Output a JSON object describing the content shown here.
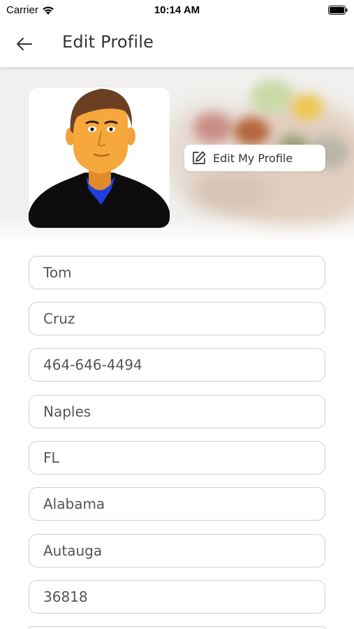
{
  "status_bar": {
    "carrier": "Carrier",
    "time": "10:14 AM"
  },
  "header": {
    "title": "Edit Profile"
  },
  "profile": {
    "edit_button_label": "Edit My Profile"
  },
  "form": {
    "fields": [
      {
        "name": "first-name",
        "value": "Tom"
      },
      {
        "name": "last-name",
        "value": "Cruz"
      },
      {
        "name": "phone",
        "value": "464-646-4494"
      },
      {
        "name": "city",
        "value": "Naples"
      },
      {
        "name": "state-code",
        "value": "FL"
      },
      {
        "name": "state",
        "value": "Alabama"
      },
      {
        "name": "county",
        "value": "Autauga"
      },
      {
        "name": "zip",
        "value": "36818"
      }
    ]
  },
  "colors": {
    "avatar_skin": "#f6a83d",
    "avatar_hair": "#6b3f24",
    "avatar_shirt": "#0d0d0d",
    "avatar_collar": "#1f3fe0",
    "field_border": "#cfcfcf"
  }
}
